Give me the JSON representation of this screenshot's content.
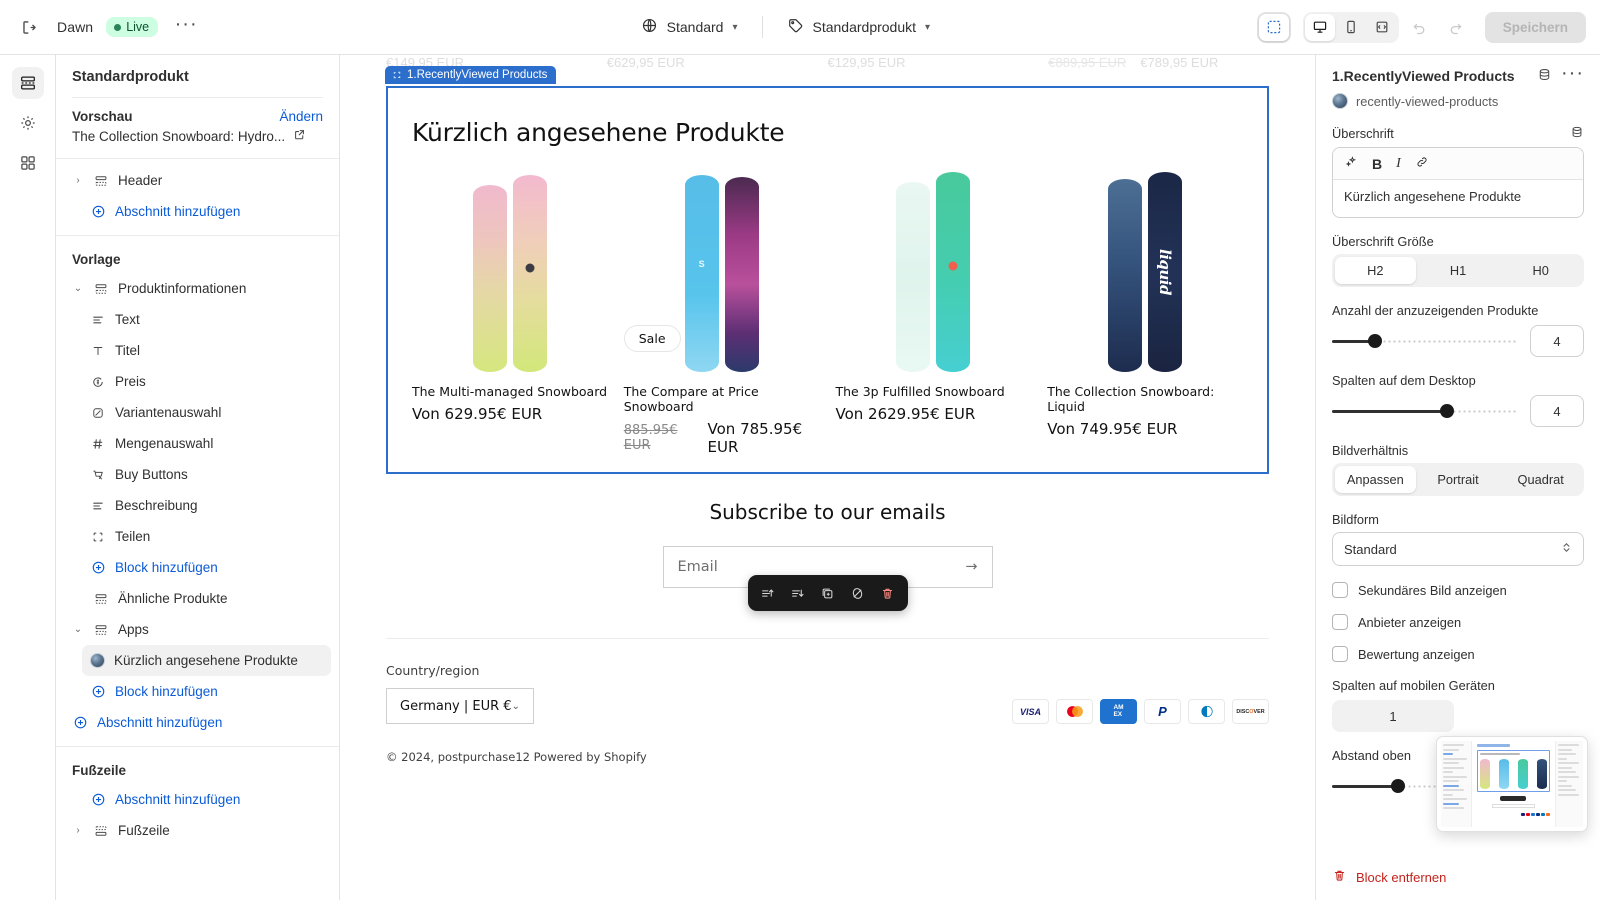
{
  "topbar": {
    "exit_icon": "exit-icon",
    "theme_name": "Dawn",
    "live_label": "Live",
    "more_icon": "ellipsis-icon",
    "locale": {
      "icon": "globe-icon",
      "label": "Standard",
      "chevron": "chevron-down-icon"
    },
    "template": {
      "icon": "tag-icon",
      "label": "Standardprodukt",
      "chevron": "chevron-down-icon"
    },
    "view_buttons": [
      {
        "name": "inspector-toggle",
        "icon": "cursor-select-icon",
        "active": true
      },
      {
        "name": "desktop-view",
        "icon": "desktop-icon",
        "active": true
      },
      {
        "name": "mobile-view",
        "icon": "mobile-icon",
        "active": false
      },
      {
        "name": "fullscreen-view",
        "icon": "fullwidth-icon",
        "active": false
      }
    ],
    "undo_label": "undo-icon",
    "redo_label": "redo-icon",
    "save_label": "Speichern"
  },
  "rail": [
    {
      "name": "sections-rail",
      "icon": "sections-icon",
      "active": true
    },
    {
      "name": "settings-rail",
      "icon": "gear-icon",
      "active": false
    },
    {
      "name": "apps-rail",
      "icon": "apps-grid-icon",
      "active": false
    }
  ],
  "sidebar": {
    "title": "Standardprodukt",
    "preview": {
      "label": "Vorschau",
      "change_link": "Ändern",
      "value": "The Collection Snowboard: Hydro...",
      "external_icon": "external-link-icon"
    },
    "header_group": {
      "items": [
        {
          "label": "Header",
          "icon": "section-icon",
          "caret": "chevron-right-icon",
          "type": "section"
        },
        {
          "label": "Abschnitt hinzufügen",
          "icon": "plus-circle-icon",
          "type": "add"
        }
      ]
    },
    "template_group": {
      "title": "Vorlage",
      "items": [
        {
          "label": "Produktinformationen",
          "icon": "section-icon",
          "caret": "chevron-down-icon",
          "type": "section",
          "indent": 0
        },
        {
          "label": "Text",
          "icon": "text-lines-icon",
          "type": "block",
          "indent": 1
        },
        {
          "label": "Titel",
          "icon": "type-t-icon",
          "type": "block",
          "indent": 1
        },
        {
          "label": "Preis",
          "icon": "price-tag-icon",
          "type": "block",
          "indent": 1
        },
        {
          "label": "Variantenauswahl",
          "icon": "variant-icon",
          "type": "block",
          "indent": 1
        },
        {
          "label": "Mengenauswahl",
          "icon": "hash-icon",
          "type": "block",
          "indent": 1
        },
        {
          "label": "Buy Buttons",
          "icon": "cart-cursor-icon",
          "type": "block",
          "indent": 1
        },
        {
          "label": "Beschreibung",
          "icon": "text-lines-icon",
          "type": "block",
          "indent": 1
        },
        {
          "label": "Teilen",
          "icon": "share-corners-icon",
          "type": "block",
          "indent": 1
        },
        {
          "label": "Block hinzufügen",
          "icon": "plus-circle-icon",
          "type": "add",
          "indent": 1
        },
        {
          "label": "Ähnliche Produkte",
          "icon": "section-icon",
          "type": "section",
          "indent": 0
        },
        {
          "label": "Apps",
          "icon": "section-icon",
          "caret": "chevron-down-icon",
          "type": "section",
          "indent": 0
        },
        {
          "label": "Kürzlich angesehene Produkte",
          "icon": "app-badge-icon",
          "type": "app-block",
          "indent": 1,
          "selected": true
        },
        {
          "label": "Block hinzufügen",
          "icon": "plus-circle-icon",
          "type": "add",
          "indent": 1
        },
        {
          "label": "Abschnitt hinzufügen",
          "icon": "plus-circle-icon",
          "type": "add",
          "indent": 0
        }
      ]
    },
    "footer_group": {
      "title": "Fußzeile",
      "items": [
        {
          "label": "Abschnitt hinzufügen",
          "icon": "plus-circle-icon",
          "type": "add"
        },
        {
          "label": "Fußzeile",
          "icon": "footer-icon",
          "caret": "chevron-right-icon",
          "type": "section"
        }
      ]
    }
  },
  "canvas": {
    "cut_prices": [
      "€149,95 EUR",
      "€629,95 EUR",
      "€129,95 EUR",
      "€889,95 EUR",
      "€789,95 EUR"
    ],
    "section_tag": "1.RecentlyViewed Products",
    "section_heading": "Kürzlich angesehene Produkte",
    "products": [
      {
        "title": "The Multi-managed Snowboard",
        "price": "Von 629.95€ EUR",
        "compare_at": "",
        "badge": ""
      },
      {
        "title": "The Compare at Price Snowboard",
        "price": "Von 785.95€ EUR",
        "compare_at": "885.95€ EUR",
        "badge": "Sale"
      },
      {
        "title": "The 3p Fulfilled Snowboard",
        "price": "Von 2629.95€ EUR",
        "compare_at": "",
        "badge": ""
      },
      {
        "title": "The Collection Snowboard: Liquid",
        "price": "Von 749.95€ EUR",
        "compare_at": "",
        "badge": "",
        "board_word": "liquid"
      }
    ],
    "section_toolbar": [
      {
        "name": "move-up-button",
        "icon": "move-up-icon"
      },
      {
        "name": "move-down-button",
        "icon": "move-down-icon"
      },
      {
        "name": "duplicate-button",
        "icon": "duplicate-icon"
      },
      {
        "name": "hide-button",
        "icon": "hide-eye-icon"
      },
      {
        "name": "delete-button",
        "icon": "trash-icon"
      }
    ],
    "subscribe": {
      "title": "Subscribe to our emails",
      "email_placeholder": "Email",
      "submit_icon": "arrow-right-icon"
    },
    "footer": {
      "country_label": "Country/region",
      "country_value": "Germany | EUR €",
      "country_chevron": "chevron-down-icon",
      "payment_icons": [
        "VISA",
        "Mastercard",
        "AMEX",
        "PayPal",
        "Diners Club",
        "DISCOVER"
      ],
      "copyright": "© 2024, postpurchase12 Powered by Shopify"
    }
  },
  "rightpanel": {
    "title": "1.RecentlyViewed Products",
    "header_icons": [
      "database-icon",
      "ellipsis-icon"
    ],
    "app_handle": "recently-viewed-products",
    "heading_field": {
      "label": "Überschrift",
      "db_icon": "database-icon",
      "toolbar": [
        "sparkle-icon",
        "B",
        "I",
        "link-icon"
      ],
      "value": "Kürzlich angesehene Produkte"
    },
    "heading_size": {
      "label": "Überschrift Größe",
      "options": [
        "H2",
        "H1",
        "H0"
      ],
      "selected": "H2"
    },
    "product_count": {
      "label": "Anzahl der anzuzeigenden Produkte",
      "value": "4",
      "percent": 23
    },
    "desktop_columns": {
      "label": "Spalten auf dem Desktop",
      "value": "4",
      "percent": 62
    },
    "image_ratio": {
      "label": "Bildverhältnis",
      "options": [
        "Anpassen",
        "Portrait",
        "Quadrat"
      ],
      "selected": "Anpassen"
    },
    "image_shape": {
      "label": "Bildform",
      "value": "Standard",
      "chevron": "updown-chevron-icon"
    },
    "checkboxes": [
      {
        "label": "Sekundäres Bild anzeigen",
        "checked": false
      },
      {
        "label": "Anbieter anzeigen",
        "checked": false
      },
      {
        "label": "Bewertung anzeigen",
        "checked": false
      }
    ],
    "mobile_columns": {
      "label": "Spalten auf mobilen Geräten",
      "value": "1"
    },
    "spacing_top": {
      "label": "Abstand oben",
      "value": "36",
      "unit": "px",
      "percent": 38
    },
    "remove_block": {
      "label": "Block entfernen",
      "icon": "trash-icon"
    }
  }
}
